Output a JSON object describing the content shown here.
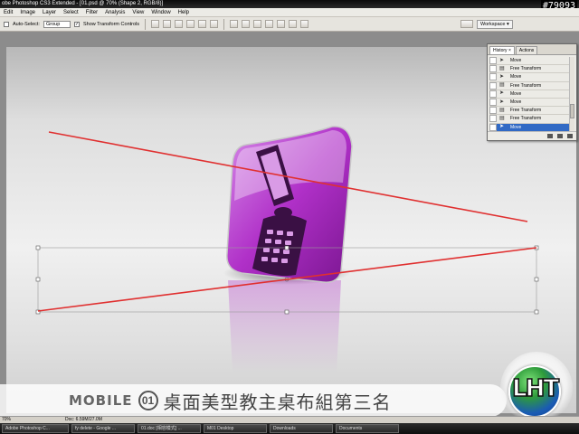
{
  "window": {
    "title": "obe Photoshop CS3 Extended - [01.psd @ 70% (Shape 2, RGB/8)]",
    "watermark_id": "#79093"
  },
  "menu": [
    "Edit",
    "Image",
    "Layer",
    "Select",
    "Filter",
    "Analysis",
    "View",
    "Window",
    "Help"
  ],
  "options": {
    "auto_select_label": "Auto-Select:",
    "auto_select_value": "Group",
    "show_transform_label": "Show Transform Controls",
    "workspace_label": "Workspace ▾"
  },
  "history_panel": {
    "tabs": [
      "History ×",
      "Actions"
    ],
    "rows": [
      "Move",
      "Free Transform",
      "Move",
      "Free Transform",
      "Move",
      "Move",
      "Free Transform",
      "Free Transform",
      "Move"
    ],
    "active_index": 8
  },
  "statusbar": {
    "zoom": "70%",
    "doc": "Doc: 6.59M/27.0M"
  },
  "taskbar": [
    "Adobe Photoshop C...",
    "fy delete - Google ...",
    "01.doc [相容模式] ...",
    "M01 Desktop",
    "Downloads",
    "Documents"
  ],
  "banner": {
    "brand": "MOBILE",
    "badge": "01",
    "title": "桌面美型教主桌布組第三名",
    "logo": "LHT"
  },
  "colors": {
    "accent_line": "#e03030",
    "phone_purple": "#b030c8",
    "selection": "#316ac5"
  }
}
